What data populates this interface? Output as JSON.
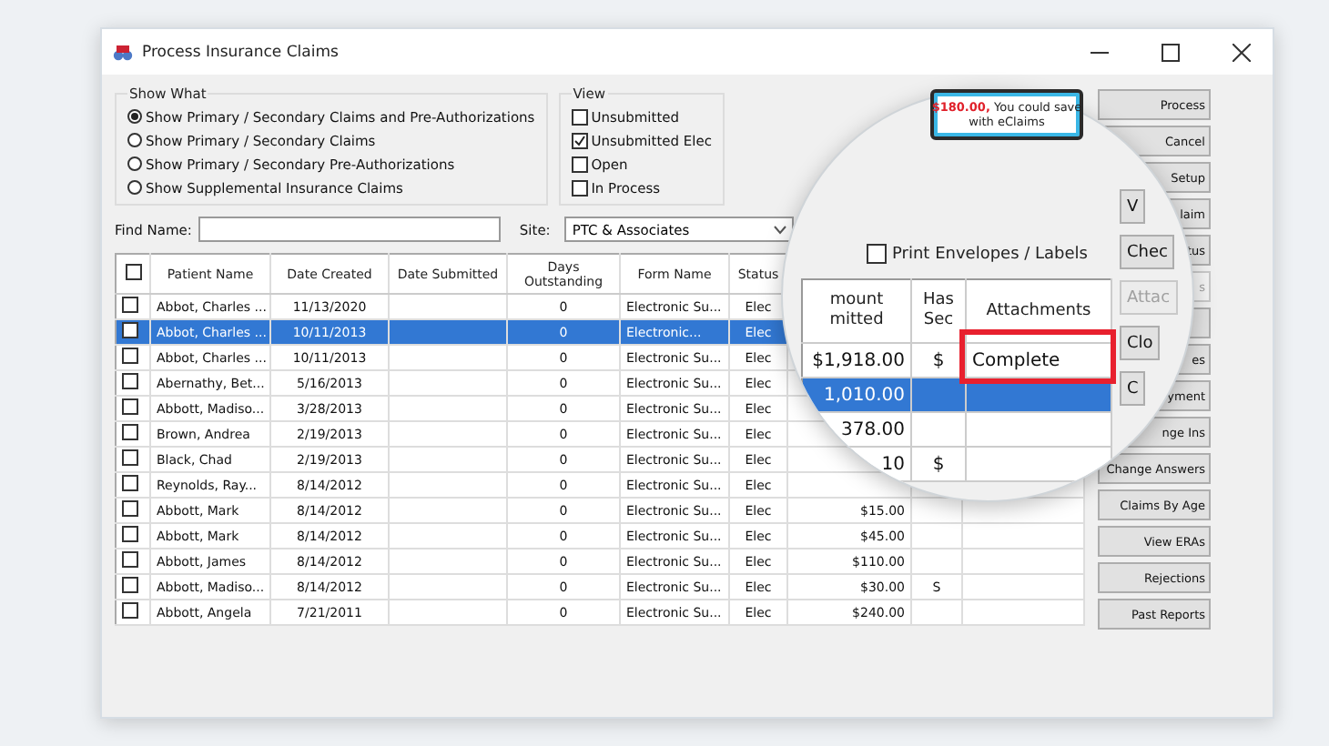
{
  "window": {
    "title": "Process Insurance Claims"
  },
  "show_what": {
    "title": "Show What",
    "options": [
      {
        "label": "Show Primary / Secondary Claims and Pre-Authorizations",
        "selected": true
      },
      {
        "label": "Show Primary / Secondary Claims",
        "selected": false
      },
      {
        "label": "Show Primary / Secondary Pre-Authorizations",
        "selected": false
      },
      {
        "label": "Show Supplemental Insurance Claims",
        "selected": false
      }
    ]
  },
  "view": {
    "title": "View",
    "options": [
      {
        "label": "Unsubmitted",
        "checked": false
      },
      {
        "label": "Unsubmitted Elec",
        "checked": true
      },
      {
        "label": "Open",
        "checked": false
      },
      {
        "label": "In Process",
        "checked": false
      }
    ]
  },
  "callout": {
    "amount": "$180.00,",
    "line_1": "You could save",
    "line_2": "with eClaims"
  },
  "find": {
    "label": "Find Name:",
    "site_label": "Site:",
    "site_value": "PTC & Associates"
  },
  "table": {
    "select_all_checked": false,
    "columns": [
      "Patient Name",
      "Date Created",
      "Date Submitted",
      "Days Outstanding",
      "Form Name",
      "Status"
    ],
    "rows": [
      {
        "patient": "Abbot, Charles ...",
        "created": "11/13/2020",
        "days": "0",
        "form": "Electronic Su...",
        "status": "Elec",
        "checked": false,
        "selected": false
      },
      {
        "patient": "Abbot, Charles ...",
        "created": "10/11/2013",
        "days": "0",
        "form": "Electronic...",
        "status": "Elec",
        "checked": false,
        "selected": true
      },
      {
        "patient": "Abbot, Charles ...",
        "created": "10/11/2013",
        "days": "0",
        "form": "Electronic Su...",
        "status": "Elec",
        "checked": false,
        "selected": false
      },
      {
        "patient": "Abernathy, Bet...",
        "created": "5/16/2013",
        "days": "0",
        "form": "Electronic Su...",
        "status": "Elec",
        "checked": false,
        "selected": false
      },
      {
        "patient": "Abbott, Madiso...",
        "created": "3/28/2013",
        "days": "0",
        "form": "Electronic Su...",
        "status": "Elec",
        "checked": false,
        "selected": false
      },
      {
        "patient": "Brown, Andrea",
        "created": "2/19/2013",
        "days": "0",
        "form": "Electronic Su...",
        "status": "Elec",
        "checked": false,
        "selected": false
      },
      {
        "patient": "Black, Chad",
        "created": "2/19/2013",
        "days": "0",
        "form": "Electronic Su...",
        "status": "Elec",
        "checked": false,
        "selected": false
      },
      {
        "patient": "Reynolds, Ray...",
        "created": "8/14/2012",
        "days": "0",
        "form": "Electronic Su...",
        "status": "Elec",
        "checked": false,
        "selected": false
      },
      {
        "patient": "Abbott, Mark",
        "created": "8/14/2012",
        "days": "0",
        "form": "Electronic Su...",
        "status": "Elec",
        "amount": "$15.00",
        "checked": false,
        "selected": false
      },
      {
        "patient": "Abbott, Mark",
        "created": "8/14/2012",
        "days": "0",
        "form": "Electronic Su...",
        "status": "Elec",
        "amount": "$45.00",
        "checked": false,
        "selected": false
      },
      {
        "patient": "Abbott, James",
        "created": "8/14/2012",
        "days": "0",
        "form": "Electronic Su...",
        "status": "Elec",
        "amount": "$110.00",
        "checked": false,
        "selected": false
      },
      {
        "patient": "Abbott, Madiso...",
        "created": "8/14/2012",
        "days": "0",
        "form": "Electronic Su...",
        "status": "Elec",
        "amount": "$30.00",
        "has_sec": "S",
        "checked": false,
        "selected": false
      },
      {
        "patient": "Abbott, Angela",
        "created": "7/21/2011",
        "days": "0",
        "form": "Electronic Su...",
        "status": "Elec",
        "amount": "$240.00",
        "checked": false,
        "selected": false
      }
    ]
  },
  "buttons": [
    {
      "label": "Process",
      "disabled": false
    },
    {
      "label": "Cancel",
      "disabled": false
    },
    {
      "label": "Setup",
      "disabled": false
    },
    {
      "label": "laim",
      "disabled": false
    },
    {
      "label": "tus",
      "disabled": false
    },
    {
      "label": "s",
      "disabled": true
    },
    {
      "disabled": false
    },
    {
      "label": "es",
      "disabled": false
    },
    {
      "label": "yment",
      "disabled": false
    },
    {
      "label": "nge Ins",
      "disabled": false
    },
    {
      "label": "Change Answers",
      "disabled": false
    },
    {
      "label": "Claims By Age",
      "disabled": false
    },
    {
      "label": "View ERAs",
      "disabled": false
    },
    {
      "label": "Rejections",
      "disabled": false
    },
    {
      "label": "Past Reports",
      "disabled": false
    }
  ],
  "magnifier": {
    "print_label": "Print Envelopes / Labels",
    "print_checked": false,
    "columns": [
      "mount mitted",
      "Has Sec",
      "Attachments"
    ],
    "rows": [
      {
        "amount": "$1,918.00",
        "has_sec": "$",
        "attachments": "Complete",
        "selected": false,
        "highlighted": true
      },
      {
        "amount": "1,010.00",
        "selected": true,
        "highlighted": false
      },
      {
        "amount": "378.00",
        "selected": false,
        "highlighted": false
      },
      {
        "amount": "10",
        "has_sec": "$",
        "selected": false,
        "highlighted": false
      }
    ],
    "buttons": [
      {
        "label": "V",
        "disabled": false
      },
      {
        "label": "Chec",
        "disabled": false
      },
      {
        "label": "Attac",
        "disabled": true
      },
      {
        "label": "Clo",
        "disabled": false
      },
      {
        "label": "C",
        "disabled": false
      }
    ]
  }
}
